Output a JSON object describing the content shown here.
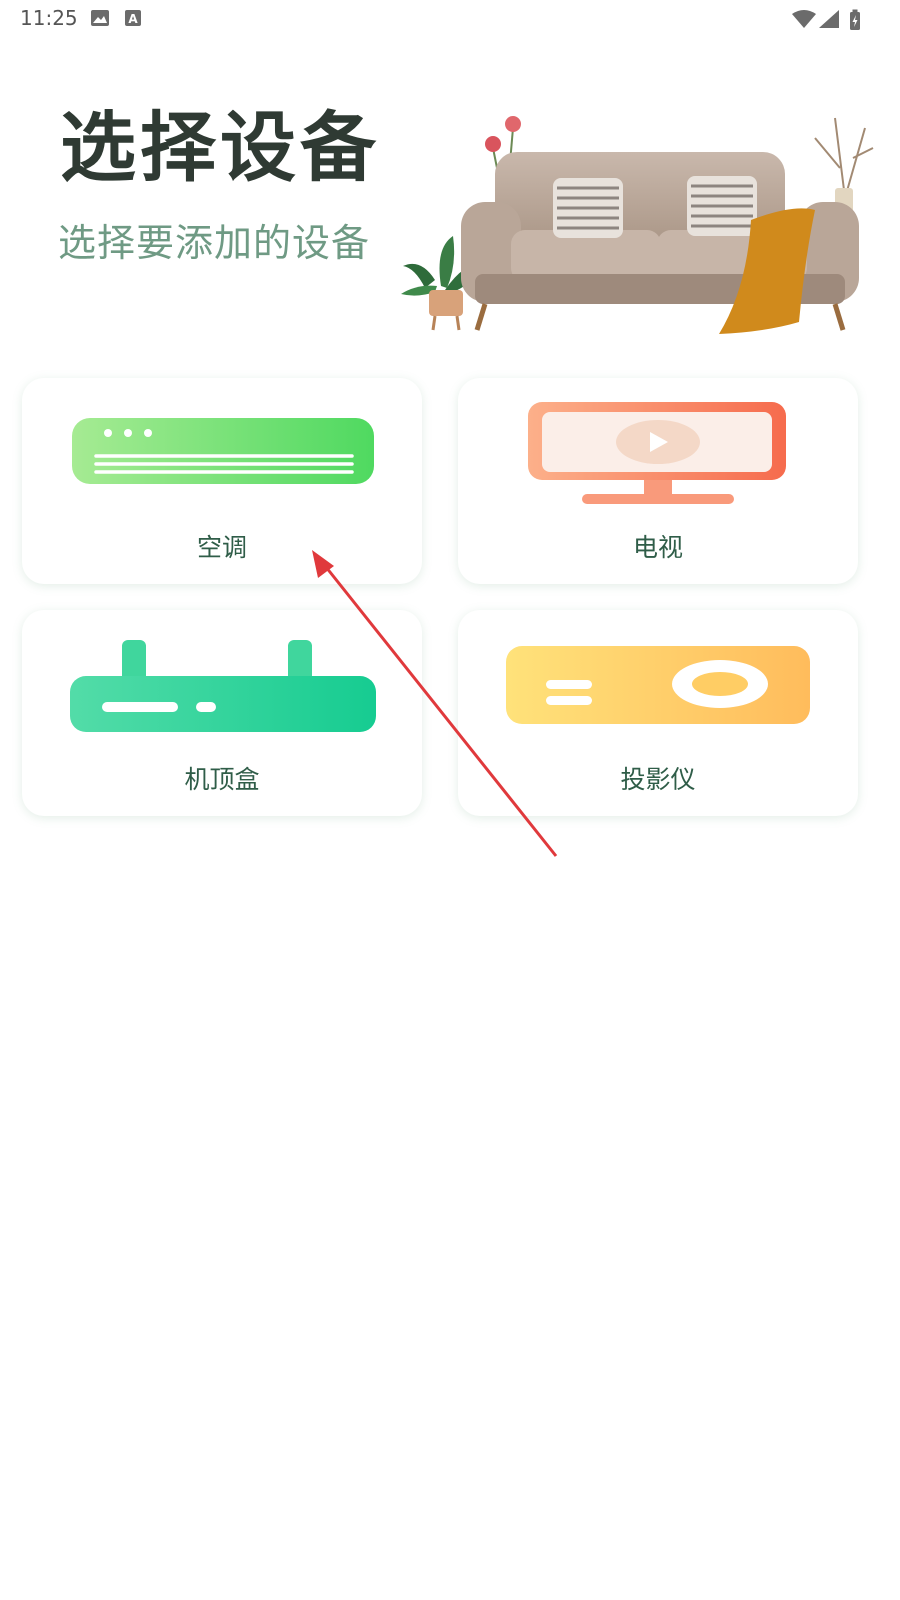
{
  "status_bar": {
    "time": "11:25",
    "icons": [
      "image-icon",
      "a-icon",
      "wifi-icon",
      "signal-icon",
      "battery-charging-icon"
    ]
  },
  "header": {
    "title": "选择设备",
    "subtitle": "选择要添加的设备"
  },
  "devices": [
    {
      "label": "空调",
      "icon": "air-conditioner-icon",
      "color": "#57d46b"
    },
    {
      "label": "电视",
      "icon": "tv-icon",
      "color": "#f88a6b"
    },
    {
      "label": "机顶盒",
      "icon": "set-top-box-icon",
      "color": "#2fd49b"
    },
    {
      "label": "投影仪",
      "icon": "projector-icon",
      "color": "#ffc560"
    }
  ],
  "colors": {
    "title": "#2f3a33",
    "subtitle": "#6f9a84",
    "label": "#2f5d48",
    "annotation_arrow": "#e0393c"
  }
}
